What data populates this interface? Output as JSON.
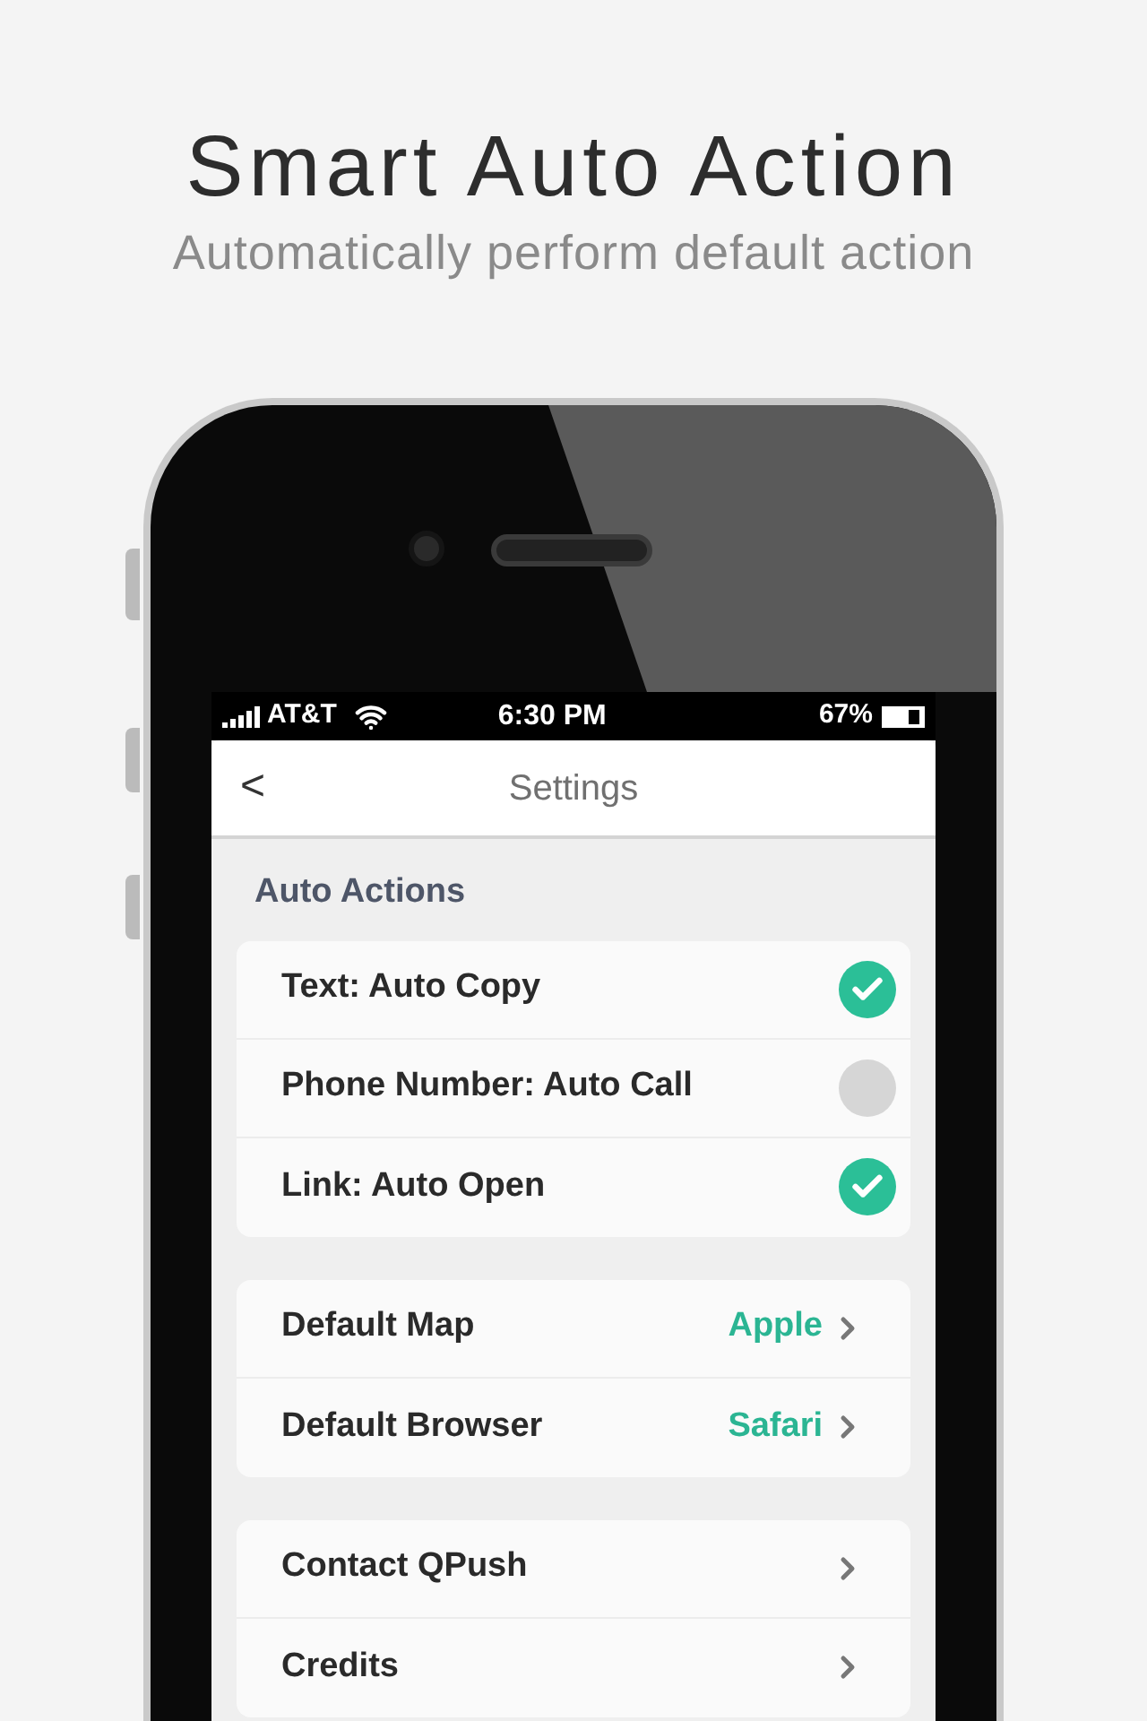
{
  "headline": "Smart Auto Action",
  "subtitle": "Automatically perform default action",
  "status_bar": {
    "carrier": "AT&T",
    "time": "6:30 PM",
    "battery": "67%",
    "battery_meter": {
      "level": 0.67
    }
  },
  "nav": {
    "back": "<",
    "title": "Settings"
  },
  "section": "Auto Actions",
  "toggles": [
    {
      "label": "Text: Auto Copy",
      "checked": true
    },
    {
      "label": "Phone Number: Auto Call",
      "checked": false
    },
    {
      "label": "Link: Auto Open",
      "checked": true
    }
  ],
  "groups": [
    [
      {
        "label": "Default Map",
        "value": "Apple"
      },
      {
        "label": "Default Browser",
        "value": "Safari"
      }
    ],
    [
      {
        "label": "Contact QPush"
      },
      {
        "label": "Credits"
      }
    ]
  ]
}
